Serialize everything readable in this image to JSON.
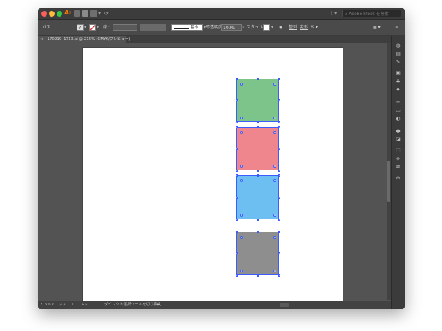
{
  "app": {
    "logo": "Ai",
    "search_placeholder": "Adobe Stock を検索",
    "workspace_dropdown": "▾"
  },
  "control_bar": {
    "selection_label": "パス",
    "stroke_label": "線 :",
    "stroke_style": "基本",
    "opacity_label": "不透明度 :",
    "opacity_value": "100%",
    "style_label": "スタイル :",
    "align_label": "整列",
    "transform_label": "変形"
  },
  "document": {
    "tab_title": "170219_1713.ai @ 215% (CMYK/プレビュー)",
    "close": "×"
  },
  "shapes": [
    {
      "name": "green-square",
      "color": "#7cc48a"
    },
    {
      "name": "pink-square",
      "color": "#ef868d"
    },
    {
      "name": "blue-square",
      "color": "#6dbff1"
    },
    {
      "name": "gray-square",
      "color": "#8e8e8e"
    }
  ],
  "status": {
    "zoom": "215%",
    "page": "1",
    "tool_hint": "ダイレクト選択ツールを切り換え"
  },
  "colors": {
    "selection": "#3d5cff",
    "close_red": "#fc605c",
    "minimize_yellow": "#fdbc40",
    "zoom_green": "#34c84a",
    "logo_orange": "#ff7c00"
  }
}
